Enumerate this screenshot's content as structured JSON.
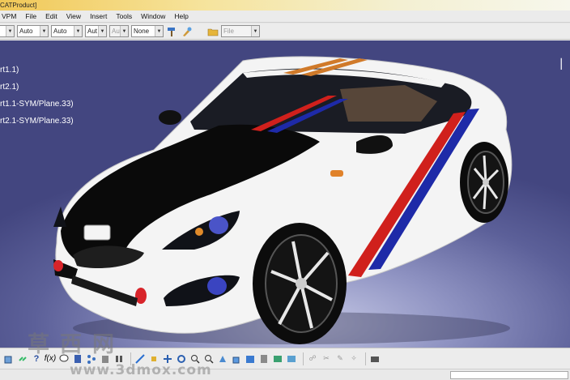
{
  "window": {
    "title": "CATProduct]"
  },
  "menu": {
    "items": [
      "VPM",
      "File",
      "Edit",
      "View",
      "Insert",
      "Tools",
      "Window",
      "Help"
    ]
  },
  "toolbar": {
    "combos": [
      {
        "value": "",
        "disabled": false
      },
      {
        "value": "Auto",
        "disabled": false
      },
      {
        "value": "Auto",
        "disabled": false
      },
      {
        "value": "Aut",
        "disabled": false
      },
      {
        "value": "Aut",
        "disabled": true
      },
      {
        "value": "None",
        "disabled": false
      },
      {
        "value": "File",
        "disabled": true
      }
    ]
  },
  "tree": {
    "items": [
      "rt1.1)",
      "rt2.1)",
      "rt1.1-SYM/Plane.33)",
      "rt2.1-SYM/Plane.33)"
    ]
  },
  "watermark": {
    "chinese": "草西网",
    "url": "www.3dmox.com"
  },
  "colors": {
    "viewport_bg": "#5c6099",
    "car_body": "#f2f2f2",
    "hood": "#0a0a0a",
    "stripe_red": "#d0201c",
    "stripe_blue": "#1e2aa8",
    "stripe_orange": "#d07a2a"
  },
  "bottom_toolbar": {
    "icons": [
      "cube-icon",
      "link-icon",
      "question-icon",
      "formula-icon",
      "chat-icon",
      "grid-icon",
      "tree-icon",
      "group-icon",
      "fly-icon",
      "fit-all-icon",
      "pan-icon",
      "rotate-icon",
      "zoom-in-icon",
      "zoom-out-icon",
      "normal-view-icon",
      "iso-view-icon",
      "shading-icon",
      "hide-show-icon",
      "swap-icon",
      "measure-icon",
      "material-icon",
      "camera-icon"
    ]
  }
}
